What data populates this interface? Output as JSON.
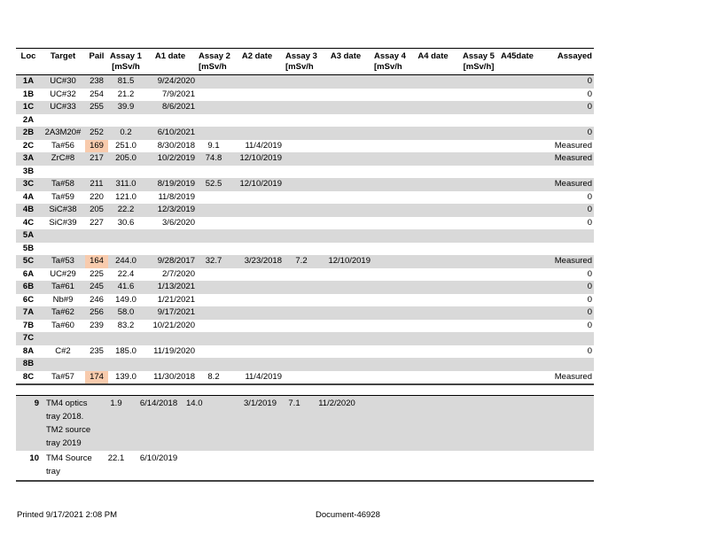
{
  "columns": [
    {
      "key": "loc",
      "label": "Loc",
      "sub": ""
    },
    {
      "key": "target",
      "label": "Target",
      "sub": ""
    },
    {
      "key": "pail",
      "label": "Pail",
      "sub": ""
    },
    {
      "key": "a1",
      "label": "Assay 1",
      "sub": "[mSv/h"
    },
    {
      "key": "d1",
      "label": "A1 date",
      "sub": ""
    },
    {
      "key": "a2",
      "label": "Assay 2",
      "sub": "[mSv/h"
    },
    {
      "key": "d2",
      "label": "A2 date",
      "sub": ""
    },
    {
      "key": "a3",
      "label": "Assay 3",
      "sub": "[mSv/h"
    },
    {
      "key": "d3",
      "label": "A3 date",
      "sub": ""
    },
    {
      "key": "a4",
      "label": "Assay 4",
      "sub": "[mSv/h"
    },
    {
      "key": "d4",
      "label": "A4 date",
      "sub": ""
    },
    {
      "key": "a5",
      "label": "Assay 5",
      "sub": "[mSv/h]"
    },
    {
      "key": "d5",
      "label": "A45date",
      "sub": ""
    },
    {
      "key": "assayed",
      "label": "Assayed",
      "sub": ""
    }
  ],
  "highlight_color": "#f8cbad",
  "stripe_color": "#d9d9d9",
  "rows": [
    {
      "loc": "1A",
      "target": "UC#30",
      "pail": "238",
      "a1": "81.5",
      "d1": "9/24/2020",
      "a2": "",
      "d2": "",
      "a3": "",
      "d3": "",
      "a4": "",
      "d4": "",
      "a5": "",
      "d5": "",
      "assayed": "0",
      "highlight": false
    },
    {
      "loc": "1B",
      "target": "UC#32",
      "pail": "254",
      "a1": "21.2",
      "d1": "7/9/2021",
      "a2": "",
      "d2": "",
      "a3": "",
      "d3": "",
      "a4": "",
      "d4": "",
      "a5": "",
      "d5": "",
      "assayed": "0",
      "highlight": false
    },
    {
      "loc": "1C",
      "target": "UC#33",
      "pail": "255",
      "a1": "39.9",
      "d1": "8/6/2021",
      "a2": "",
      "d2": "",
      "a3": "",
      "d3": "",
      "a4": "",
      "d4": "",
      "a5": "",
      "d5": "",
      "assayed": "0",
      "highlight": false
    },
    {
      "loc": "2A",
      "target": "",
      "pail": "",
      "a1": "",
      "d1": "",
      "a2": "",
      "d2": "",
      "a3": "",
      "d3": "",
      "a4": "",
      "d4": "",
      "a5": "",
      "d5": "",
      "assayed": "",
      "highlight": false
    },
    {
      "loc": "2B",
      "target": "2A3M20#",
      "pail": "252",
      "a1": "0.2",
      "d1": "6/10/2021",
      "a2": "",
      "d2": "",
      "a3": "",
      "d3": "",
      "a4": "",
      "d4": "",
      "a5": "",
      "d5": "",
      "assayed": "0",
      "highlight": false
    },
    {
      "loc": "2C",
      "target": "Ta#56",
      "pail": "169",
      "a1": "251.0",
      "d1": "8/30/2018",
      "a2": "9.1",
      "d2": "11/4/2019",
      "a3": "",
      "d3": "",
      "a4": "",
      "d4": "",
      "a5": "",
      "d5": "",
      "assayed": "Measured",
      "highlight": true
    },
    {
      "loc": "3A",
      "target": "ZrC#8",
      "pail": "217",
      "a1": "205.0",
      "d1": "10/2/2019",
      "a2": "74.8",
      "d2": "12/10/2019",
      "a3": "",
      "d3": "",
      "a4": "",
      "d4": "",
      "a5": "",
      "d5": "",
      "assayed": "Measured",
      "highlight": false
    },
    {
      "loc": "3B",
      "target": "",
      "pail": "",
      "a1": "",
      "d1": "",
      "a2": "",
      "d2": "",
      "a3": "",
      "d3": "",
      "a4": "",
      "d4": "",
      "a5": "",
      "d5": "",
      "assayed": "",
      "highlight": false
    },
    {
      "loc": "3C",
      "target": "Ta#58",
      "pail": "211",
      "a1": "311.0",
      "d1": "8/19/2019",
      "a2": "52.5",
      "d2": "12/10/2019",
      "a3": "",
      "d3": "",
      "a4": "",
      "d4": "",
      "a5": "",
      "d5": "",
      "assayed": "Measured",
      "highlight": false
    },
    {
      "loc": "4A",
      "target": "Ta#59",
      "pail": "220",
      "a1": "121.0",
      "d1": "11/8/2019",
      "a2": "",
      "d2": "",
      "a3": "",
      "d3": "",
      "a4": "",
      "d4": "",
      "a5": "",
      "d5": "",
      "assayed": "0",
      "highlight": false
    },
    {
      "loc": "4B",
      "target": "SiC#38",
      "pail": "205",
      "a1": "22.2",
      "d1": "12/3/2019",
      "a2": "",
      "d2": "",
      "a3": "",
      "d3": "",
      "a4": "",
      "d4": "",
      "a5": "",
      "d5": "",
      "assayed": "0",
      "highlight": false
    },
    {
      "loc": "4C",
      "target": "SiC#39",
      "pail": "227",
      "a1": "30.6",
      "d1": "3/6/2020",
      "a2": "",
      "d2": "",
      "a3": "",
      "d3": "",
      "a4": "",
      "d4": "",
      "a5": "",
      "d5": "",
      "assayed": "0",
      "highlight": false
    },
    {
      "loc": "5A",
      "target": "",
      "pail": "",
      "a1": "",
      "d1": "",
      "a2": "",
      "d2": "",
      "a3": "",
      "d3": "",
      "a4": "",
      "d4": "",
      "a5": "",
      "d5": "",
      "assayed": "",
      "highlight": false
    },
    {
      "loc": "5B",
      "target": "",
      "pail": "",
      "a1": "",
      "d1": "",
      "a2": "",
      "d2": "",
      "a3": "",
      "d3": "",
      "a4": "",
      "d4": "",
      "a5": "",
      "d5": "",
      "assayed": "",
      "highlight": false
    },
    {
      "loc": "5C",
      "target": "Ta#53",
      "pail": "164",
      "a1": "244.0",
      "d1": "9/28/2017",
      "a2": "32.7",
      "d2": "3/23/2018",
      "a3": "7.2",
      "d3": "12/10/2019",
      "a4": "",
      "d4": "",
      "a5": "",
      "d5": "",
      "assayed": "Measured",
      "highlight": true
    },
    {
      "loc": "6A",
      "target": "UC#29",
      "pail": "225",
      "a1": "22.4",
      "d1": "2/7/2020",
      "a2": "",
      "d2": "",
      "a3": "",
      "d3": "",
      "a4": "",
      "d4": "",
      "a5": "",
      "d5": "",
      "assayed": "0",
      "highlight": false
    },
    {
      "loc": "6B",
      "target": "Ta#61",
      "pail": "245",
      "a1": "41.6",
      "d1": "1/13/2021",
      "a2": "",
      "d2": "",
      "a3": "",
      "d3": "",
      "a4": "",
      "d4": "",
      "a5": "",
      "d5": "",
      "assayed": "0",
      "highlight": false
    },
    {
      "loc": "6C",
      "target": "Nb#9",
      "pail": "246",
      "a1": "149.0",
      "d1": "1/21/2021",
      "a2": "",
      "d2": "",
      "a3": "",
      "d3": "",
      "a4": "",
      "d4": "",
      "a5": "",
      "d5": "",
      "assayed": "0",
      "highlight": false
    },
    {
      "loc": "7A",
      "target": "Ta#62",
      "pail": "256",
      "a1": "58.0",
      "d1": "9/17/2021",
      "a2": "",
      "d2": "",
      "a3": "",
      "d3": "",
      "a4": "",
      "d4": "",
      "a5": "",
      "d5": "",
      "assayed": "0",
      "highlight": false
    },
    {
      "loc": "7B",
      "target": "Ta#60",
      "pail": "239",
      "a1": "83.2",
      "d1": "10/21/2020",
      "a2": "",
      "d2": "",
      "a3": "",
      "d3": "",
      "a4": "",
      "d4": "",
      "a5": "",
      "d5": "",
      "assayed": "0",
      "highlight": false
    },
    {
      "loc": "7C",
      "target": "",
      "pail": "",
      "a1": "",
      "d1": "",
      "a2": "",
      "d2": "",
      "a3": "",
      "d3": "",
      "a4": "",
      "d4": "",
      "a5": "",
      "d5": "",
      "assayed": "",
      "highlight": false
    },
    {
      "loc": "8A",
      "target": "C#2",
      "pail": "235",
      "a1": "185.0",
      "d1": "11/19/2020",
      "a2": "",
      "d2": "",
      "a3": "",
      "d3": "",
      "a4": "",
      "d4": "",
      "a5": "",
      "d5": "",
      "assayed": "0",
      "highlight": false
    },
    {
      "loc": "8B",
      "target": "",
      "pail": "",
      "a1": "",
      "d1": "",
      "a2": "",
      "d2": "",
      "a3": "",
      "d3": "",
      "a4": "",
      "d4": "",
      "a5": "",
      "d5": "",
      "assayed": "",
      "highlight": false
    },
    {
      "loc": "8C",
      "target": "Ta#57",
      "pail": "174",
      "a1": "139.0",
      "d1": "11/30/2018",
      "a2": "8.2",
      "d2": "11/4/2019",
      "a3": "",
      "d3": "",
      "a4": "",
      "d4": "",
      "a5": "",
      "d5": "",
      "assayed": "Measured",
      "highlight": true
    }
  ],
  "extra_rows": [
    {
      "loc": "9",
      "target": "TM4 optics tray 2018. TM2 source tray 2019",
      "a1": "1.9",
      "d1": "6/14/2018",
      "a2": "14.0",
      "d2": "3/1/2019",
      "a3": "7.1",
      "d3": "11/2/2020"
    },
    {
      "loc": "10",
      "target": "TM4 Source tray",
      "a1": "22.1",
      "d1": "6/10/2019",
      "a2": "",
      "d2": "",
      "a3": "",
      "d3": ""
    }
  ],
  "footer": {
    "printed": "Printed 9/17/2021 2:08 PM",
    "document_id": "Document-46928"
  }
}
